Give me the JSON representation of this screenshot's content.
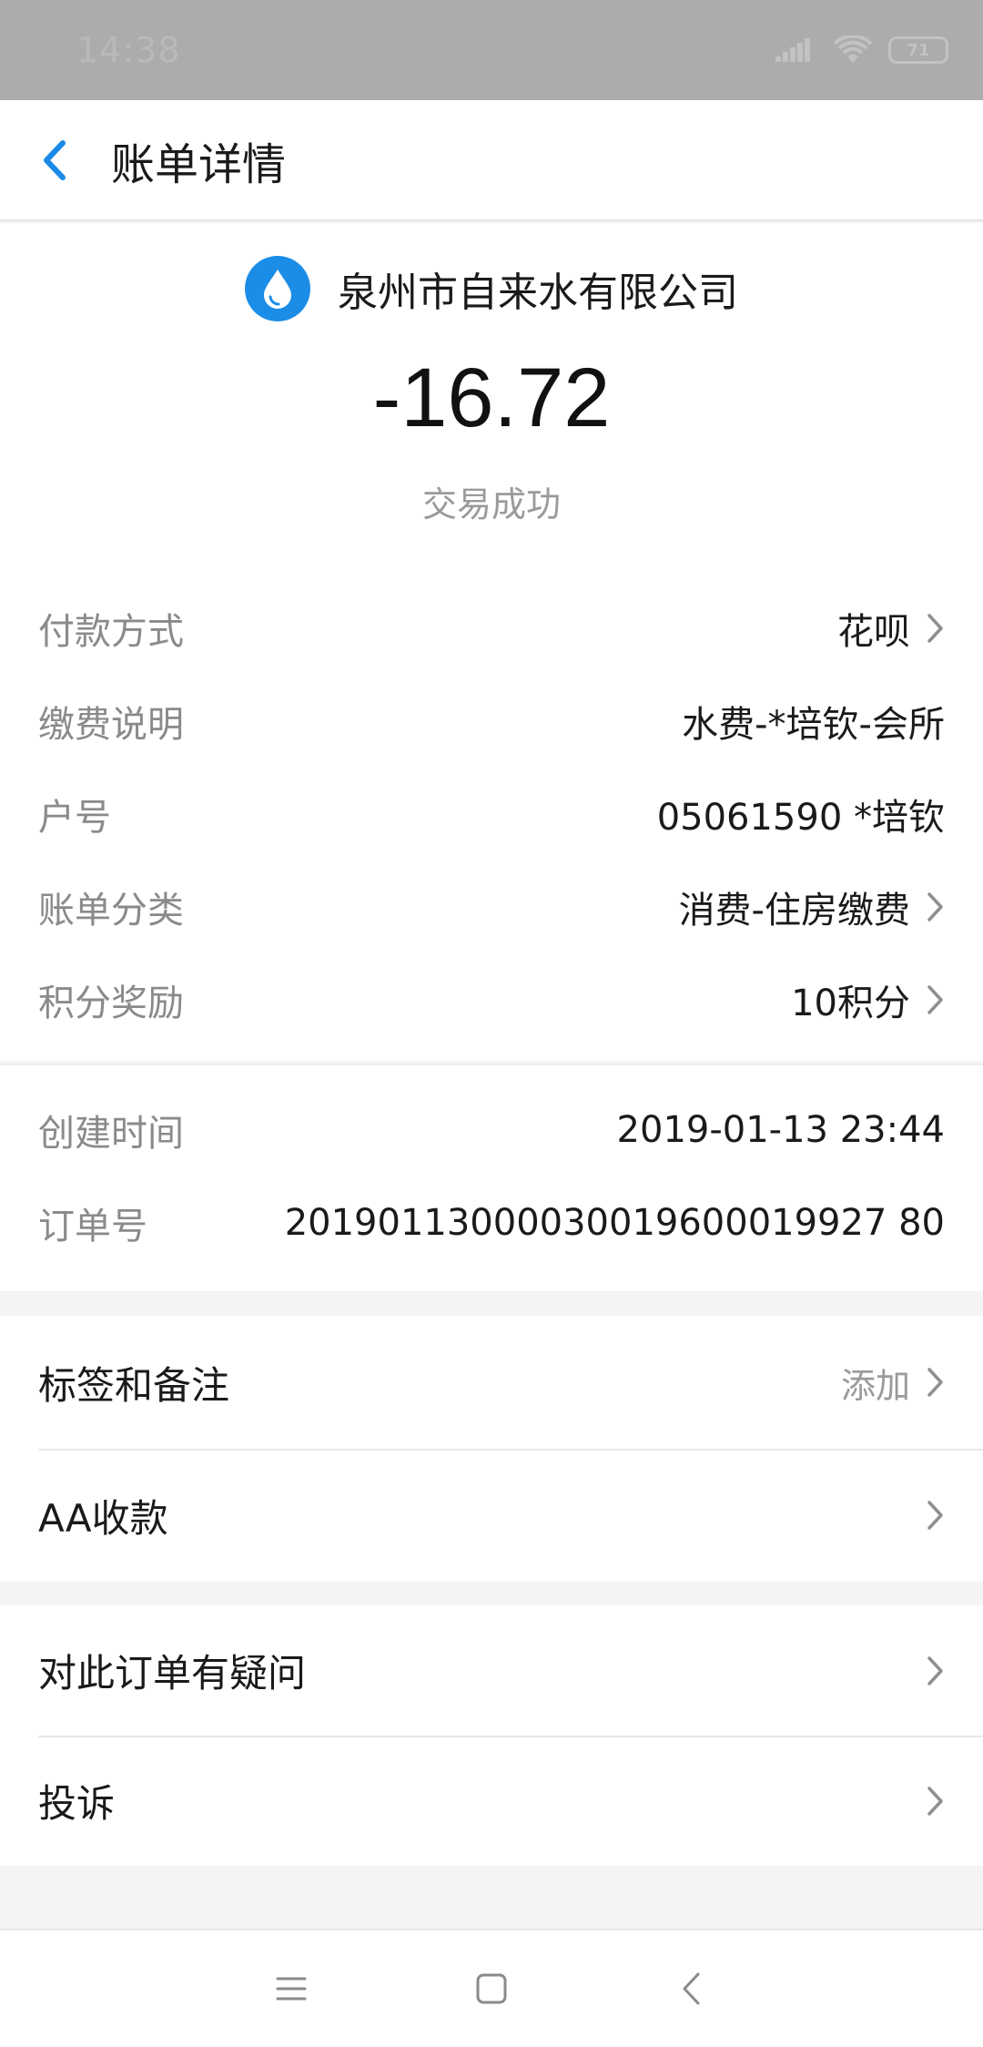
{
  "status_bar": {
    "time": "14:38",
    "battery": "71"
  },
  "nav": {
    "title": "账单详情"
  },
  "summary": {
    "merchant": "泉州市自来水有限公司",
    "amount": "-16.72",
    "status": "交易成功"
  },
  "details": [
    {
      "label": "付款方式",
      "value": "花呗"
    },
    {
      "label": "缴费说明",
      "value": "水费-*培钦-会所"
    },
    {
      "label": "户号",
      "value": "05061590 *培钦"
    },
    {
      "label": "账单分类",
      "value": "消费-住房缴费"
    },
    {
      "label": "积分奖励",
      "value": "10积分"
    }
  ],
  "meta": [
    {
      "label": "创建时间",
      "value": "2019-01-13 23:44"
    },
    {
      "label": "订单号",
      "value": "20190113000030019600019927 80"
    }
  ],
  "actions_a": [
    {
      "label": "标签和备注",
      "hint": "添加"
    },
    {
      "label": "AA收款"
    }
  ],
  "actions_b": [
    {
      "label": "对此订单有疑问"
    },
    {
      "label": "投诉"
    }
  ],
  "colors": {
    "brand_blue": "#1c8de7",
    "back_blue": "#1a8ae6"
  }
}
